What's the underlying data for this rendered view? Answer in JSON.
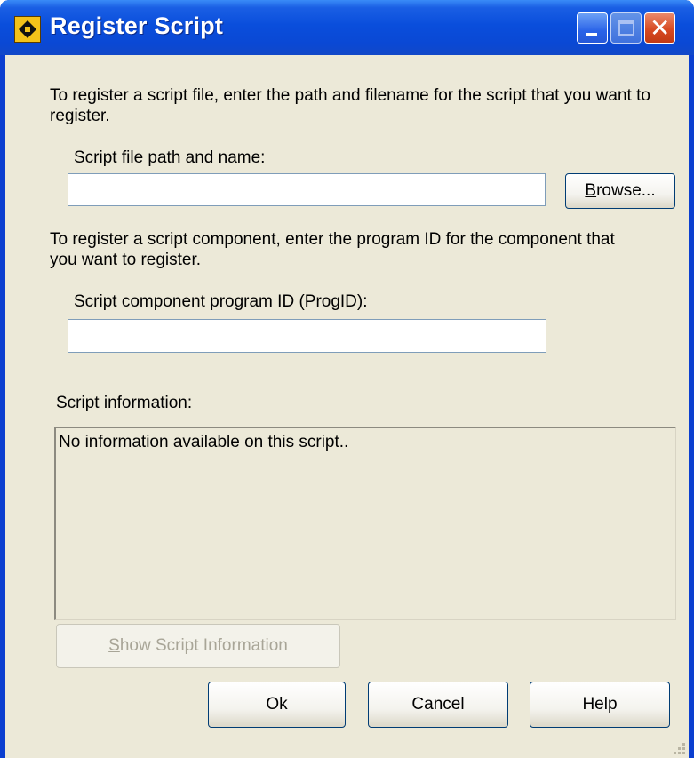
{
  "window": {
    "title": "Register Script",
    "controls": {
      "minimize": "minimize",
      "maximize": "maximize",
      "close": "close"
    }
  },
  "form": {
    "intro_file": "To register a script file, enter the path and filename for the script that you want to register.",
    "path_label": "Script file path and name:",
    "path_value": "",
    "intro_component": "To register a script component, enter the program ID for the component that you want to register.",
    "progid_label": "Script component program ID (ProgID):",
    "progid_value": "",
    "info_label": "Script information:",
    "info_text": "No information available on this script.."
  },
  "buttons": {
    "browse_mnemonic": "B",
    "browse_rest": "rowse...",
    "show_mnemonic": "S",
    "show_rest": "how Script Information",
    "ok": "Ok",
    "cancel": "Cancel",
    "help": "Help"
  },
  "colors": {
    "titlebar": "#0a4edc",
    "dialog_bg": "#ece9d8",
    "input_border": "#7f9db9",
    "button_border": "#003c74",
    "disabled_text": "#a8a597"
  }
}
